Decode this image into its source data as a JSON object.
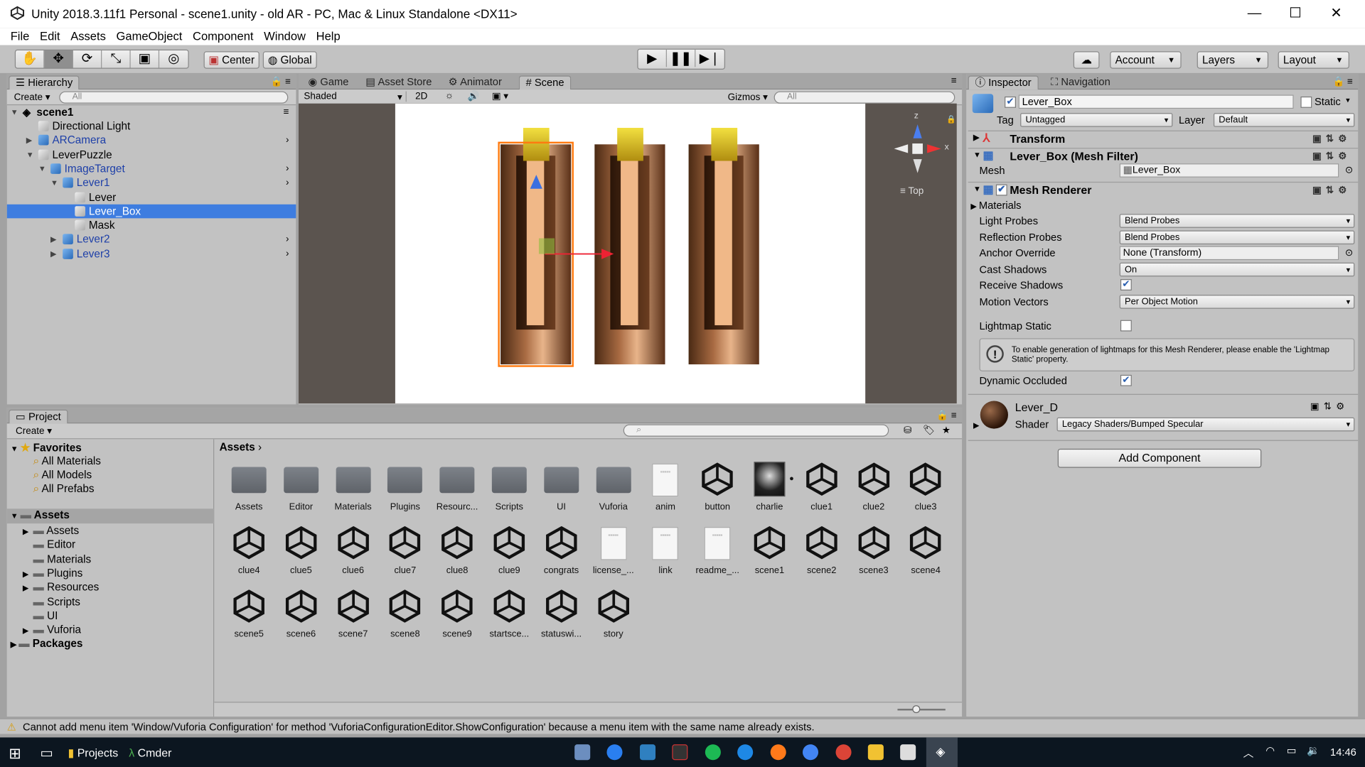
{
  "window": {
    "title": "Unity 2018.3.11f1 Personal - scene1.unity - old AR - PC, Mac & Linux Standalone <DX11>",
    "minimize": "—",
    "maximize": "☐",
    "close": "✕"
  },
  "menu": [
    "File",
    "Edit",
    "Assets",
    "GameObject",
    "Component",
    "Window",
    "Help"
  ],
  "toolbar": {
    "pivot": "Center",
    "space": "Global",
    "account": "Account",
    "layers": "Layers",
    "layout": "Layout"
  },
  "hierarchy": {
    "tab": "Hierarchy",
    "create": "Create",
    "search": "All",
    "scene": "scene1",
    "rows": [
      {
        "label": "Directional Light",
        "indent": 1
      },
      {
        "label": "ARCamera",
        "indent": 1
      },
      {
        "label": "LeverPuzzle",
        "indent": 1
      },
      {
        "label": "ImageTarget",
        "indent": 2
      },
      {
        "label": "Lever1",
        "indent": 3
      },
      {
        "label": "Lever",
        "indent": 4
      },
      {
        "label": "Lever_Box",
        "indent": 4
      },
      {
        "label": "Mask",
        "indent": 4
      },
      {
        "label": "Lever2",
        "indent": 3
      },
      {
        "label": "Lever3",
        "indent": 3
      }
    ]
  },
  "scene_tabs": [
    "Game",
    "Asset Store",
    "Animator",
    "Scene"
  ],
  "scene_bar": {
    "shading": "Shaded",
    "mode2d": "2D",
    "gizmos": "Gizmos",
    "search": "All"
  },
  "scene_gizmo": {
    "axis_z": "z",
    "axis_x": "x",
    "view": "Top"
  },
  "project": {
    "tab": "Project",
    "create": "Create",
    "breadcrumb": "Assets",
    "favorites": {
      "title": "Favorites",
      "items": [
        "All Materials",
        "All Models",
        "All Prefabs"
      ]
    },
    "assets_tree": {
      "title": "Assets",
      "items": [
        "Assets",
        "Editor",
        "Materials",
        "Plugins",
        "Resources",
        "Scripts",
        "UI",
        "Vuforia"
      ]
    },
    "packages": "Packages",
    "grid": [
      {
        "name": "Assets",
        "kind": "folder"
      },
      {
        "name": "Editor",
        "kind": "folder"
      },
      {
        "name": "Materials",
        "kind": "folder"
      },
      {
        "name": "Plugins",
        "kind": "folder"
      },
      {
        "name": "Resourc...",
        "kind": "folder"
      },
      {
        "name": "Scripts",
        "kind": "folder"
      },
      {
        "name": "UI",
        "kind": "folder"
      },
      {
        "name": "Vuforia",
        "kind": "folder"
      },
      {
        "name": "anim",
        "kind": "doc"
      },
      {
        "name": "button",
        "kind": "unity"
      },
      {
        "name": "charlie",
        "kind": "image"
      },
      {
        "name": "clue1",
        "kind": "unity"
      },
      {
        "name": "clue2",
        "kind": "unity"
      },
      {
        "name": "clue3",
        "kind": "unity"
      },
      {
        "name": "clue4",
        "kind": "unity"
      },
      {
        "name": "clue5",
        "kind": "unity"
      },
      {
        "name": "clue6",
        "kind": "unity"
      },
      {
        "name": "clue7",
        "kind": "unity"
      },
      {
        "name": "clue8",
        "kind": "unity"
      },
      {
        "name": "clue9",
        "kind": "unity"
      },
      {
        "name": "congrats",
        "kind": "unity"
      },
      {
        "name": "license_...",
        "kind": "doc"
      },
      {
        "name": "link",
        "kind": "doc"
      },
      {
        "name": "readme_...",
        "kind": "doc"
      },
      {
        "name": "scene1",
        "kind": "unity"
      },
      {
        "name": "scene2",
        "kind": "unity"
      },
      {
        "name": "scene3",
        "kind": "unity"
      },
      {
        "name": "scene4",
        "kind": "unity"
      },
      {
        "name": "scene5",
        "kind": "unity"
      },
      {
        "name": "scene6",
        "kind": "unity"
      },
      {
        "name": "scene7",
        "kind": "unity"
      },
      {
        "name": "scene8",
        "kind": "unity"
      },
      {
        "name": "scene9",
        "kind": "unity"
      },
      {
        "name": "startsce...",
        "kind": "unity"
      },
      {
        "name": "statuswi...",
        "kind": "unity"
      },
      {
        "name": "story",
        "kind": "unity"
      }
    ]
  },
  "inspector": {
    "tabs": [
      "Inspector",
      "Navigation"
    ],
    "object_name": "Lever_Box",
    "static_label": "Static",
    "tag_label": "Tag",
    "tag_value": "Untagged",
    "layer_label": "Layer",
    "layer_value": "Default",
    "transform": "Transform",
    "mesh_filter": "Lever_Box (Mesh Filter)",
    "mesh_label": "Mesh",
    "mesh_value": "Lever_Box",
    "mesh_renderer": "Mesh Renderer",
    "materials": "Materials",
    "props": [
      {
        "label": "Light Probes",
        "value": "Blend Probes"
      },
      {
        "label": "Reflection Probes",
        "value": "Blend Probes"
      },
      {
        "label": "Anchor Override",
        "value": "None (Transform)"
      },
      {
        "label": "Cast Shadows",
        "value": "On"
      },
      {
        "label": "Receive Shadows",
        "value": "✔"
      },
      {
        "label": "Motion Vectors",
        "value": "Per Object Motion"
      },
      {
        "label": "Lightmap Static",
        "value": ""
      }
    ],
    "info": "To enable generation of lightmaps for this Mesh Renderer, please enable the 'Lightmap Static' property.",
    "dynamic_occluded": "Dynamic Occluded",
    "dynamic_check": "✔",
    "material_name": "Lever_D",
    "shader_label": "Shader",
    "shader_value": "Legacy Shaders/Bumped Specular",
    "add_component": "Add Component"
  },
  "status": "Cannot add menu item 'Window/Vuforia Configuration' for method 'VuforiaConfigurationEditor.ShowConfiguration' because a menu item with the same name already exists.",
  "taskbar": {
    "projects": "Projects",
    "cmder": "Cmder",
    "time": "14:46"
  },
  "colors": {
    "selection": "#3e7de0",
    "panel": "#c2c2c2",
    "scene_bg": "#5b544f",
    "taskbar": "#0c1620"
  }
}
